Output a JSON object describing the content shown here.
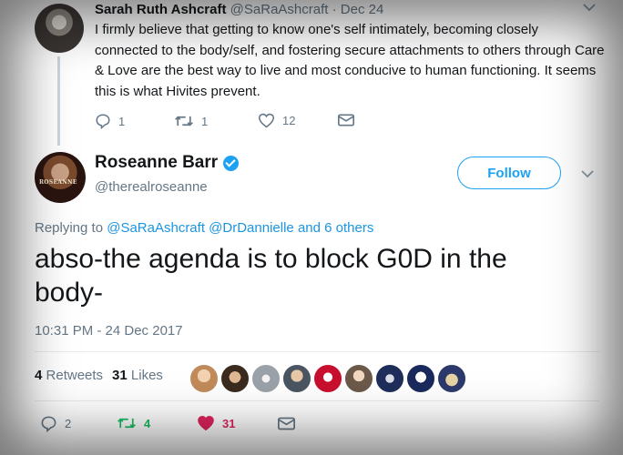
{
  "parent_tweet": {
    "name": "Sarah Ruth Ashcraft",
    "handle": "@SaRaAshcraft",
    "separator": "·",
    "date": "Dec 24",
    "text": "I firmly believe that getting to know one's self intimately, becoming closely connected to the body/self, and fostering secure attachments to others through Care & Love are the best way to live and most conducive to human functioning. It seems this is what Hivites prevent.",
    "actions": {
      "replies": "1",
      "retweets": "1",
      "likes": "12"
    }
  },
  "main_tweet": {
    "name": "Roseanne Barr",
    "handle": "@therealroseanne",
    "avatar_logo_text": "ROSEANNE",
    "follow_label": "Follow",
    "replying_prefix": "Replying to",
    "replying_user1": "@SaRaAshcraft",
    "replying_user2": "@DrDannielle",
    "replying_suffix": "and 6 others",
    "text": "abso-the agenda is to block G0D in the body-",
    "timestamp": "10:31 PM - 24 Dec 2017",
    "retweets_count": "4",
    "retweets_label": "Retweets",
    "likes_count": "31",
    "likes_label": "Likes",
    "actions": {
      "replies": "2",
      "retweets": "4",
      "likes": "31"
    }
  },
  "colors": {
    "accent": "#1da1f2",
    "text_primary": "#14171a",
    "text_secondary": "#657786",
    "retweet_active": "#17bf63",
    "like_active": "#e0245e"
  },
  "icons": {
    "reply": "reply-icon",
    "retweet": "retweet-icon",
    "like": "heart-icon",
    "dm": "envelope-icon",
    "verified": "verified-badge-icon",
    "more": "chevron-down-icon"
  }
}
